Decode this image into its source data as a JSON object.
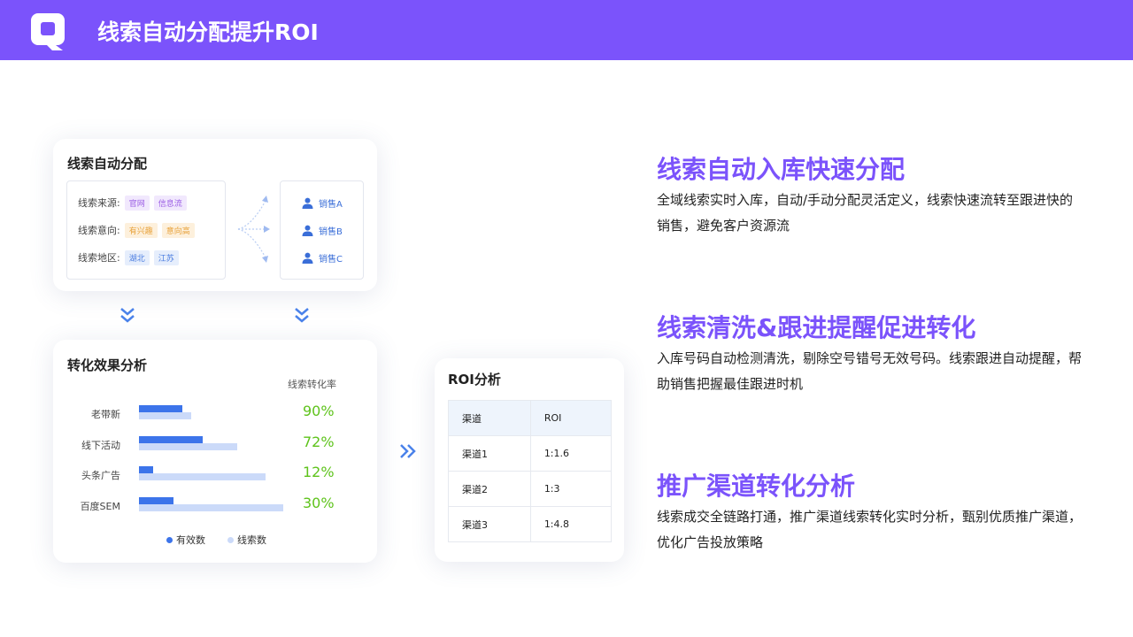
{
  "header": {
    "title": "线索自动分配提升ROI",
    "accent_color": "#7b53fb",
    "logo_icon": "chat-bubble-logo-icon"
  },
  "assign_card": {
    "title": "线索自动分配",
    "attributes": [
      {
        "label": "线索来源:",
        "tags": [
          "官网",
          "信息流"
        ],
        "tag_color": "purple"
      },
      {
        "label": "线索意向:",
        "tags": [
          "有兴趣",
          "意向高"
        ],
        "tag_color": "orange"
      },
      {
        "label": "线索地区:",
        "tags": [
          "湖北",
          "江苏"
        ],
        "tag_color": "blue"
      }
    ],
    "sales": [
      "销售A",
      "销售B",
      "销售C"
    ],
    "sales_icon": "user-icon",
    "flow_icon": "down-chevron-icon"
  },
  "conversion_card": {
    "title": "转化效果分析",
    "rate_header": "线索转化率",
    "legend_valid": "有效数",
    "legend_leads": "线索数",
    "channels": [
      {
        "name": "老带新",
        "valid": 0.3,
        "leads": 0.36,
        "rate": "90%"
      },
      {
        "name": "线下活动",
        "valid": 0.44,
        "leads": 0.68,
        "rate": "72%"
      },
      {
        "name": "头条广告",
        "valid": 0.1,
        "leads": 0.88,
        "rate": "12%"
      },
      {
        "name": "百度SEM",
        "valid": 0.24,
        "leads": 1.0,
        "rate": "30%"
      }
    ],
    "colors": {
      "valid": "#3c74ea",
      "leads": "#cbdaf9",
      "rate": "#5ec31b"
    }
  },
  "roi_card": {
    "title": "ROI分析",
    "columns": [
      "渠道",
      "ROI"
    ],
    "rows": [
      [
        "渠道1",
        "1:1.6"
      ],
      [
        "渠道2",
        "1:3"
      ],
      [
        "渠道3",
        "1:4.8"
      ]
    ]
  },
  "features": [
    {
      "title": "线索自动入库快速分配",
      "desc": "全域线索实时入库，自动/手动分配灵活定义，线索快速流转至跟进快的销售，避免客户资源流"
    },
    {
      "title": "线索清洗&跟进提醒促进转化",
      "desc": "入库号码自动检测清洗，剔除空号错号无效号码。线索跟进自动提醒，帮助销售把握最佳跟进时机"
    },
    {
      "title": "推广渠道转化分析",
      "desc": "线索成交全链路打通，推广渠道线索转化实时分析，甄别优质推广渠道，优化广告投放策略"
    }
  ]
}
